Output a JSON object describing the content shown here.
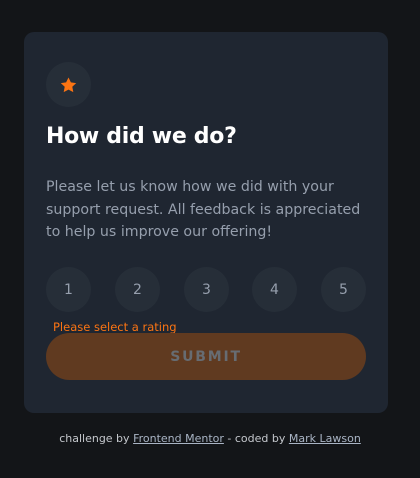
{
  "card": {
    "icon": "star-icon",
    "title": "How did we do?",
    "description": "Please let us know how we did with your support request. All feedback is appreciated to help us improve our offering!",
    "ratings": [
      "1",
      "2",
      "3",
      "4",
      "5"
    ],
    "error": "Please select a rating",
    "submit_label": "SUBMIT"
  },
  "footer": {
    "prefix": "challenge by",
    "challenge_link": "Frontend Mentor",
    "middle": "- coded by",
    "author_link": "Mark Lawson"
  },
  "colors": {
    "background": "#131518",
    "card": "#1f2631",
    "circle": "#262e38",
    "accent": "#fb7413",
    "text_muted": "#969fad",
    "submit_disabled": "#603a20"
  }
}
